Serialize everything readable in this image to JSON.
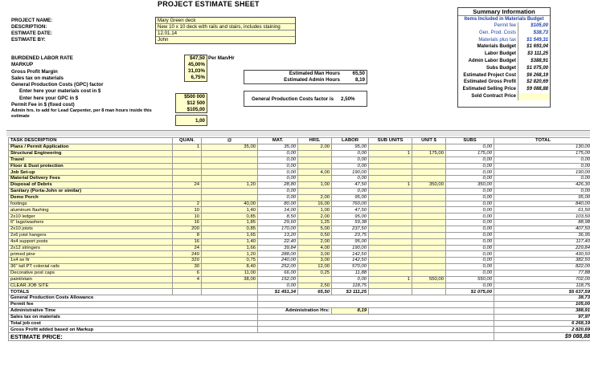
{
  "title": "PROJECT ESTIMATE SHEET",
  "project": {
    "labels": [
      "PROJECT NAME:",
      "DESCRIPTION:",
      "ESTIMATE DATE:",
      "ESTIMATE BY:"
    ],
    "values": [
      "Mary Green deck",
      "New 10 x 10 deck with rails and stairs, includes staining",
      "12.01.14",
      "John"
    ]
  },
  "settings": {
    "labels": [
      "BURDENED LABOR RATE",
      "MARKUP",
      "Gross Profit Margin",
      "Sales tax on materials",
      "General Production Costs (GPC) factor",
      "Enter here your materials cost in $",
      "Enter here your GPC in $",
      "Permit Fee in $ (fixed cost)",
      "Admin hrs. to add for Lead Carpenter, per 8 man hours inside this estimate"
    ],
    "values": [
      "$47,50",
      "45,00%",
      "31,03%",
      "6,75%",
      "",
      "$500 000",
      "$12 500",
      "$105,00",
      "1,00"
    ],
    "rate_unit": "Per Man/Hr"
  },
  "hours": {
    "labels": [
      "Estimated Man Hours",
      "Estimated Admin Hours"
    ],
    "values": [
      "65,50",
      "8,19"
    ]
  },
  "gpc": {
    "label": "General Production Costs factor is",
    "value": "2,50%"
  },
  "summary": {
    "title": "Summary Information",
    "subtitle": "Items Included in Materials Budget",
    "rows": [
      {
        "label": "Permit fee",
        "value": "$105,00",
        "style": "blue"
      },
      {
        "label": "Gen. Prod. Costs",
        "value": "$38,73",
        "style": "blue"
      },
      {
        "label": "Materials plus tax",
        "value": "$1 549,31",
        "style": "blue"
      },
      {
        "label": "Materials Budget",
        "value": "$1 693,04",
        "style": "bold"
      },
      {
        "label": "Labor Budget",
        "value": "$3 111,25",
        "style": "bold"
      },
      {
        "label": "Admin Labor Budget",
        "value": "$388,91",
        "style": "bold"
      },
      {
        "label": "Subs Budget",
        "value": "$1 075,00",
        "style": "bold"
      },
      {
        "label": "Estimated Project Cost",
        "value": "$6 268,19",
        "style": "bold"
      },
      {
        "label": "Estimated Gross Profit",
        "value": "$2 820,69",
        "style": "bold"
      },
      {
        "label": "Estimated Selling Price",
        "value": "$9 088,88",
        "style": "bold"
      },
      {
        "label": "Sold Contract Price",
        "value": "",
        "style": "bold"
      }
    ]
  },
  "table": {
    "headers": [
      "TASK DESCRIPTION",
      "QUAN.",
      "@",
      "MAT.",
      "HRS.",
      "LABOR",
      "SUB UNITS",
      "UNIT $",
      "SUBS",
      "TOTAL"
    ],
    "rows": [
      [
        "Plans / Permit Application",
        "1",
        "35,00",
        "35,00",
        "2,00",
        "95,00",
        "",
        "",
        "0,00",
        "130,00"
      ],
      [
        "Structural Engineering",
        "",
        "",
        "0,00",
        "",
        "0,00",
        "1",
        "175,00",
        "175,00",
        "175,00"
      ],
      [
        "Travel",
        "",
        "",
        "0,00",
        "",
        "0,00",
        "",
        "",
        "0,00",
        "0,00"
      ],
      [
        "Floor & Dust protection",
        "",
        "",
        "0,00",
        "",
        "0,00",
        "",
        "",
        "0,00",
        "0,00"
      ],
      [
        "Job Set-up",
        "",
        "",
        "0,00",
        "4,00",
        "190,00",
        "",
        "",
        "0,00",
        "190,00"
      ],
      [
        "Material Delivery Fees",
        "",
        "",
        "0,00",
        "",
        "0,00",
        "",
        "",
        "0,00",
        "0,00"
      ],
      [
        "Disposal of Debris",
        "24",
        "1,20",
        "28,80",
        "1,00",
        "47,50",
        "1",
        "350,00",
        "350,00",
        "426,30"
      ],
      [
        "Sanitary (Porta-John or similar)",
        "",
        "",
        "0,00",
        "",
        "0,00",
        "",
        "",
        "0,00",
        "0,00"
      ],
      [
        "Demo Porch",
        "",
        "",
        "0,00",
        "2,00",
        "95,00",
        "",
        "",
        "0,00",
        "95,00"
      ],
      [
        "footings",
        "2",
        "40,00",
        "80,00",
        "16,00",
        "760,00",
        "",
        "",
        "0,00",
        "840,00"
      ],
      [
        "aluminum flashing",
        "10",
        "1,40",
        "14,00",
        "1,00",
        "47,50",
        "",
        "",
        "0,00",
        "61,50"
      ],
      [
        "2x10 ledger",
        "10",
        "0,85",
        "8,50",
        "2,00",
        "95,00",
        "",
        "",
        "0,00",
        "103,50"
      ],
      [
        "6\" lags/washers",
        "16",
        "1,85",
        "29,60",
        "1,25",
        "59,38",
        "",
        "",
        "0,00",
        "88,98"
      ],
      [
        "2x10 joists",
        "200",
        "0,85",
        "170,00",
        "5,00",
        "237,50",
        "",
        "",
        "0,00",
        "407,50"
      ],
      [
        "2x6 joist hangers",
        "8",
        "1,65",
        "13,20",
        "0,50",
        "23,75",
        "",
        "",
        "0,00",
        "36,95"
      ],
      [
        "4x4 support posts",
        "16",
        "1,40",
        "22,40",
        "2,00",
        "95,00",
        "",
        "",
        "0,00",
        "117,40"
      ],
      [
        "2x12 stringers",
        "24",
        "1,66",
        "39,84",
        "4,00",
        "190,00",
        "",
        "",
        "0,00",
        "229,84"
      ],
      [
        "primed pine",
        "240",
        "1,20",
        "288,00",
        "3,00",
        "142,50",
        "",
        "",
        "0,00",
        "430,50"
      ],
      [
        "1x4 se fir",
        "320",
        "0,75",
        "240,00",
        "3,00",
        "142,50",
        "",
        "",
        "0,00",
        "382,50"
      ],
      [
        "36\" tall PT colonial rails",
        "30",
        "8,40",
        "252,00",
        "12,00",
        "570,00",
        "",
        "",
        "0,00",
        "822,00"
      ],
      [
        "Decorative post caps",
        "6",
        "11,00",
        "66,00",
        "0,25",
        "11,88",
        "",
        "",
        "0,00",
        "77,88"
      ],
      [
        "paint/stain",
        "4",
        "38,00",
        "152,00",
        "",
        "0,00",
        "1",
        "550,00",
        "550,00",
        "702,00"
      ],
      [
        "CLEAR JOB SITE",
        "",
        "",
        "0,00",
        "2,50",
        "118,75",
        "",
        "",
        "0,00",
        "118,75"
      ]
    ],
    "totals": {
      "label": "TOTALS",
      "mat": "$1 451,34",
      "hrs": "65,50",
      "labor": "$3 111,25",
      "subs": "$1 075,00",
      "total": "$5 637,59"
    },
    "footer": [
      {
        "label": "General Production Costs Allowance",
        "value": "38,73"
      },
      {
        "label": "Permit fee",
        "value": "105,00"
      },
      {
        "label": "Administrative Time",
        "value": "388,91"
      },
      {
        "label": "Sales tax on materials",
        "value": "97,97"
      },
      {
        "label": "Total job cost",
        "value": "6 268,19"
      },
      {
        "label": "Gross Profit added based on Markup",
        "value": "2 820,69"
      }
    ],
    "admin_hrs": {
      "label": "Administration Hrs:",
      "value": "8,19"
    },
    "estimate_price": {
      "label": "ESTIMATE PRICE:",
      "value": "$9 088,88"
    }
  }
}
